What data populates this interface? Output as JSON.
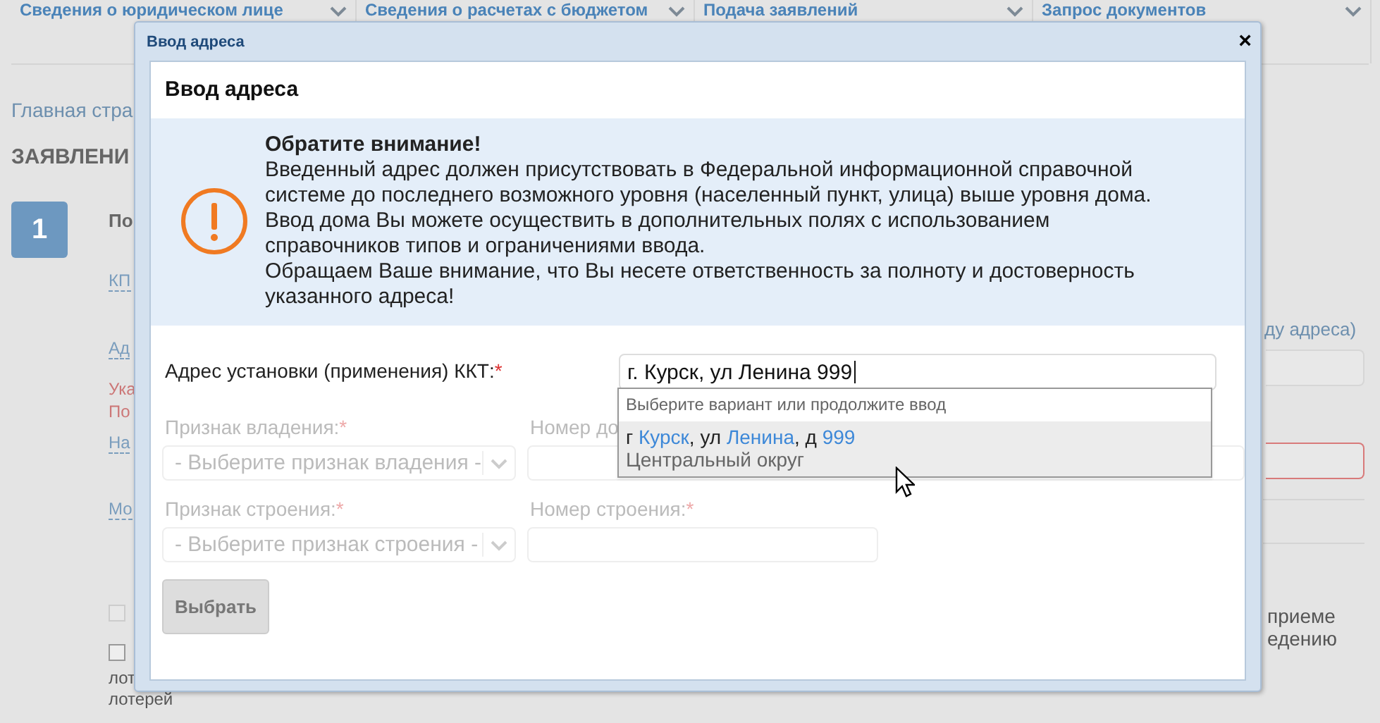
{
  "top_nav": [
    {
      "label": "Сведения о юридическом лице"
    },
    {
      "label": "Сведения о расчетах с бюджетом"
    },
    {
      "label": "Подача заявлений"
    },
    {
      "label": "Запрос документов"
    }
  ],
  "page": {
    "breadcrumb": "Главная стра",
    "heading": "ЗАЯВЛЕНИ",
    "step": "1",
    "step_title": "По",
    "left_items": [
      {
        "kind": "link",
        "text": "КП"
      },
      {
        "kind": "link",
        "text": "Ад"
      },
      {
        "kind": "error",
        "text": "Ука"
      },
      {
        "kind": "error",
        "text": "По"
      },
      {
        "kind": "link",
        "text": "На"
      },
      {
        "kind": "link",
        "text": "Мо"
      }
    ],
    "checkboxes": [
      {
        "checked": false,
        "disabled": true
      },
      {
        "checked": false,
        "disabled": false
      }
    ],
    "bottom_lines": [
      "лот",
      "лотерей"
    ],
    "right_link": "ду адреса)",
    "right_lines": [
      "приеме",
      "едению"
    ]
  },
  "dialog": {
    "title": "Ввод адреса",
    "close": "×",
    "heading": "Ввод адреса",
    "notice": {
      "title": "Обратите внимание!",
      "paragraphs": [
        "Введенный адрес должен присутствовать в Федеральной информационной справочной системе до последнего возможного уровня (населенный пункт, улица) выше уровня дома.",
        "Ввод дома Вы можете осуществить в дополнительных полях с использованием справочников типов и ограничениями ввода.",
        "Обращаем Ваше внимание, что Вы несете ответственность за полноту и достоверность указанного адреса!"
      ]
    },
    "address": {
      "label": "Адрес установки (применения) ККТ:",
      "mark": "*",
      "value": "г. Курск, ул Ленина 999"
    },
    "suggestions": {
      "hint": "Выберите вариант или продолжите ввод",
      "items": [
        {
          "selected": true,
          "parts": [
            {
              "text": "г ",
              "match": false
            },
            {
              "text": "Курск",
              "match": true
            },
            {
              "text": ", ул ",
              "match": false
            },
            {
              "text": "Ленина",
              "match": true
            },
            {
              "text": ", д ",
              "match": false
            },
            {
              "text": "999",
              "match": true
            }
          ],
          "detail": "Центральный округ"
        }
      ]
    },
    "fields": [
      {
        "kind": "select",
        "label": "Признак владения:",
        "mark": "*",
        "placeholder": "- Выберите признак владения -",
        "disabled": true
      },
      {
        "kind": "input",
        "label": "Номер до",
        "disabled": true
      },
      {
        "kind": "select",
        "label": "Признак строения:",
        "mark": "*",
        "placeholder": "- Выберите признак строения -",
        "disabled": true
      },
      {
        "kind": "input",
        "label": "Номер строения:",
        "mark": "*",
        "disabled": true
      }
    ],
    "button": {
      "label": "Выбрать",
      "disabled": true
    }
  }
}
